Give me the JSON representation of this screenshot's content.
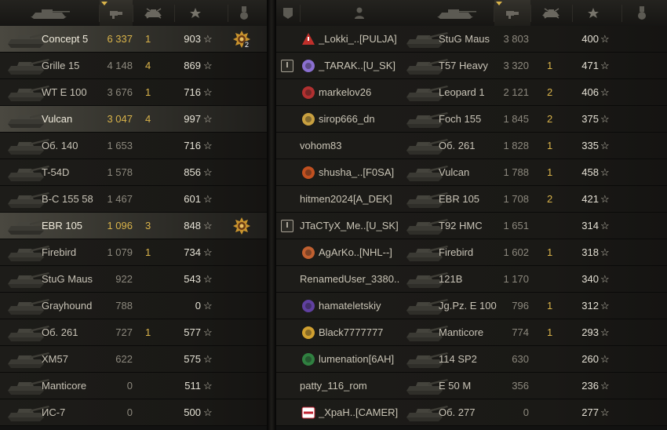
{
  "left_team": {
    "header_icons": [
      "tank-column-icon",
      "damage-column-icon",
      "kills-column-icon",
      "xp-star-icon",
      "medal-column-icon"
    ],
    "rows": [
      {
        "tank": "Concept 5",
        "damage": "6 337",
        "kills": "1",
        "xp": "903",
        "highlight": true,
        "gold": true,
        "medal": true,
        "medal_count": "2"
      },
      {
        "tank": "Grille 15",
        "damage": "4 148",
        "kills": "4",
        "xp": "869"
      },
      {
        "tank": "WT E 100",
        "damage": "3 676",
        "kills": "1",
        "xp": "716"
      },
      {
        "tank": "Vulcan",
        "damage": "3 047",
        "kills": "4",
        "xp": "997",
        "highlight": true,
        "gold": true
      },
      {
        "tank": "Об. 140",
        "damage": "1 653",
        "kills": "",
        "xp": "716"
      },
      {
        "tank": "T-54D",
        "damage": "1 578",
        "kills": "",
        "xp": "856"
      },
      {
        "tank": "B-C 155 58",
        "damage": "1 467",
        "kills": "",
        "xp": "601"
      },
      {
        "tank": "EBR 105",
        "damage": "1 096",
        "kills": "3",
        "xp": "848",
        "highlight": true,
        "gold": true,
        "medal": true
      },
      {
        "tank": "Firebird",
        "damage": "1 079",
        "kills": "1",
        "xp": "734"
      },
      {
        "tank": "StuG Maus",
        "damage": "922",
        "kills": "",
        "xp": "543"
      },
      {
        "tank": "Grayhound",
        "damage": "788",
        "kills": "",
        "xp": "0"
      },
      {
        "tank": "Об. 261",
        "damage": "727",
        "kills": "1",
        "xp": "577"
      },
      {
        "tank": "XM57",
        "damage": "622",
        "kills": "",
        "xp": "575"
      },
      {
        "tank": "Manticore",
        "damage": "0",
        "kills": "",
        "xp": "511"
      },
      {
        "tank": "ИС-7",
        "damage": "0",
        "kills": "",
        "xp": "500"
      }
    ]
  },
  "right_team": {
    "header_icons": [
      "platoon-column-icon",
      "player-column-icon",
      "tank-column-icon",
      "damage-column-icon",
      "kills-column-icon",
      "xp-star-icon",
      "medal-column-icon"
    ],
    "rows": [
      {
        "platoon": "",
        "emblem": "warning",
        "player": "_Lokki_..[PULJA]",
        "tank": "StuG Maus",
        "damage": "3 803",
        "kills": "",
        "xp": "400"
      },
      {
        "platoon": "I",
        "emblem": "shield",
        "player": "_TARAK..[U_SK]",
        "tank": "T57 Heavy",
        "damage": "3 320",
        "kills": "1",
        "xp": "471"
      },
      {
        "platoon": "",
        "emblem": "round",
        "player": "markelov26",
        "tank": "Leopard 1",
        "damage": "2 121",
        "kills": "2",
        "xp": "406"
      },
      {
        "platoon": "",
        "emblem": "gear",
        "player": "sirop666_dn",
        "tank": "Foch 155",
        "damage": "1 845",
        "kills": "2",
        "xp": "375"
      },
      {
        "platoon": "",
        "emblem": "",
        "player": "vohom83",
        "tank": "Об. 261",
        "damage": "1 828",
        "kills": "1",
        "xp": "335"
      },
      {
        "platoon": "",
        "emblem": "fox",
        "player": "shusha_..[F0SA]",
        "tank": "Vulcan",
        "damage": "1 788",
        "kills": "1",
        "xp": "458"
      },
      {
        "platoon": "",
        "emblem": "",
        "player": "hitmen2024[A_DEK]",
        "tank": "EBR 105",
        "damage": "1 708",
        "kills": "2",
        "xp": "421"
      },
      {
        "platoon": "I",
        "emblem": "",
        "player": "JTaCTyX_Me..[U_SK]",
        "tank": "T92 HMC",
        "damage": "1 651",
        "kills": "",
        "xp": "314"
      },
      {
        "platoon": "",
        "emblem": "wing",
        "player": "AgArKo..[NHL--]",
        "tank": "Firebird",
        "damage": "1 602",
        "kills": "1",
        "xp": "318"
      },
      {
        "platoon": "",
        "emblem": "",
        "player": "RenamedUser_3380..",
        "tank": "121B",
        "damage": "1 170",
        "kills": "",
        "xp": "340"
      },
      {
        "platoon": "",
        "emblem": "purple",
        "player": "hamateletskiy",
        "tank": "Jg.Pz. E 100",
        "damage": "796",
        "kills": "1",
        "xp": "312"
      },
      {
        "platoon": "",
        "emblem": "target",
        "player": "Black7777777",
        "tank": "Manticore",
        "damage": "774",
        "kills": "1",
        "xp": "293"
      },
      {
        "platoon": "",
        "emblem": "green",
        "player": "lumenation[6AH]",
        "tank": "114 SP2",
        "damage": "630",
        "kills": "",
        "xp": "260"
      },
      {
        "platoon": "",
        "emblem": "",
        "player": "patty_116_rom",
        "tank": "E 50 M",
        "damage": "356",
        "kills": "",
        "xp": "236"
      },
      {
        "platoon": "",
        "emblem": "love",
        "player": "_XpaH..[CAMER]",
        "tank": "Об. 277",
        "damage": "0",
        "kills": "",
        "xp": "277"
      }
    ]
  },
  "colors": {
    "gold": "#d9b34a",
    "text": "#c9c4b5",
    "dim": "#8c887d"
  }
}
